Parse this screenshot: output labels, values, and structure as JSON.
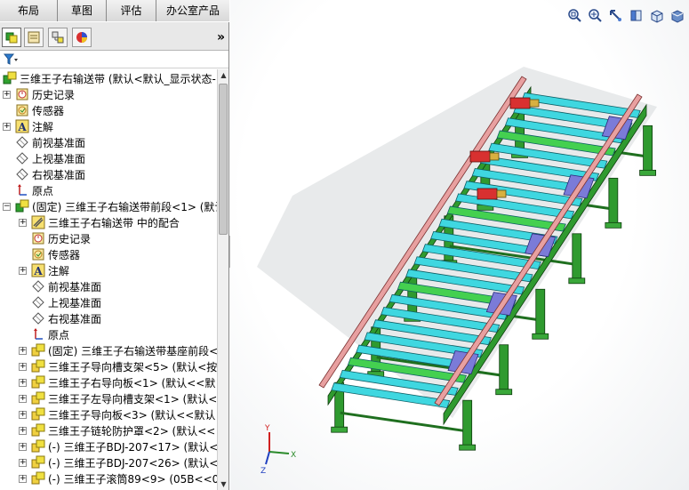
{
  "command_manager": {
    "tabs": [
      "布局",
      "草图",
      "评估",
      "办公室产品"
    ]
  },
  "panel": {
    "more_label": "»"
  },
  "tree": {
    "root": "三维王子右输送带 (默认<默认_显示状态-",
    "items": [
      "历史记录",
      "传感器",
      "注解",
      "前视基准面",
      "上视基准面",
      "右视基准面",
      "原点",
      "(固定) 三维王子右输送带前段<1> (默认",
      "三维王子右输送带 中的配合",
      "历史记录",
      "传感器",
      "注解",
      "前视基准面",
      "上视基准面",
      "右视基准面",
      "原点",
      "(固定) 三维王子右输送带基座前段<",
      "三维王子导向槽支架<5> (默认<按",
      "三维王子右导向板<1> (默认<<默",
      "三维王子左导向槽支架<1> (默认<",
      "三维王子导向板<3> (默认<<默认",
      "三维王子链轮防护罩<2> (默认<<",
      "(-) 三维王子BDJ-207<17> (默认<",
      "(-) 三维王子BDJ-207<26> (默认<",
      "(-) 三维王子滚筒89<9> (05B<<0"
    ]
  },
  "viewport": {
    "toolbar": [
      "zoom-to-fit-icon",
      "zoom-to-area-icon",
      "previous-view-icon",
      "section-view-icon",
      "view-orientation-icon",
      "display-style-icon"
    ],
    "triad": {
      "x": "X",
      "y": "Y",
      "z": "Z"
    }
  },
  "colors": {
    "roller": "#3fd7e0",
    "frame": "#2f9a2f",
    "rail": "#e8a0a0",
    "block": "#7b7bd8"
  }
}
